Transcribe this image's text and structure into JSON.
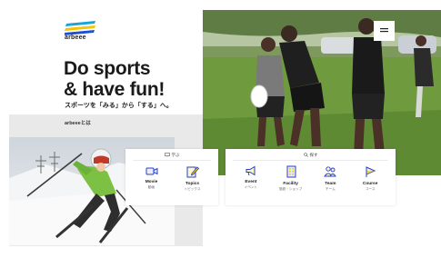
{
  "brand": {
    "name": "arbeee",
    "colors": [
      "#1d4fd6",
      "#f5c400",
      "#1aa3d9"
    ]
  },
  "hero": {
    "headline_line1": "Do sports",
    "headline_line2": "& have fun!",
    "tagline": "スポーツを「みる」から「する」へ。"
  },
  "section": {
    "label": "arbeeeとは"
  },
  "menu": {
    "icon": "hamburger-icon"
  },
  "learn": {
    "heading": "学ぶ",
    "items": [
      {
        "en": "Movie",
        "ja": "動画",
        "icon": "video-camera-icon"
      },
      {
        "en": "Topics",
        "ja": "トピックス",
        "icon": "pencil-icon"
      }
    ]
  },
  "find": {
    "heading": "探す",
    "items": [
      {
        "en": "Event",
        "ja": "イベント",
        "icon": "megaphone-icon"
      },
      {
        "en": "Facility",
        "ja": "施設・ショップ",
        "icon": "building-icon"
      },
      {
        "en": "Team",
        "ja": "チーム",
        "icon": "people-icon"
      },
      {
        "en": "Course",
        "ja": "コース",
        "icon": "flag-icon"
      }
    ]
  }
}
